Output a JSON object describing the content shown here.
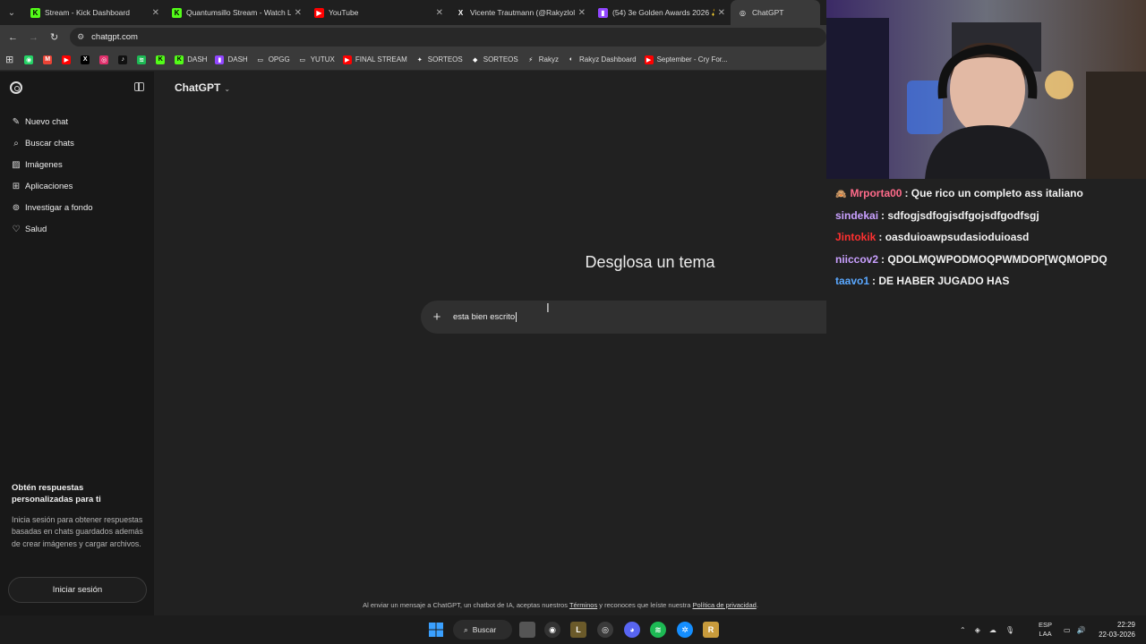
{
  "browser": {
    "tabs": [
      {
        "title": "Stream - Kick Dashboard",
        "favicon": "kick-icon",
        "color": "#53fc18",
        "glyph": "K"
      },
      {
        "title": "Quantumsillo Stream - Watch L",
        "favicon": "kick-icon",
        "color": "#53fc18",
        "glyph": "K"
      },
      {
        "title": "YouTube",
        "favicon": "youtube-icon",
        "color": "#ff0000",
        "glyph": "▶"
      },
      {
        "title": "Vicente Trautmann (@Rakyzlol",
        "favicon": "x-icon",
        "color": "#1f1f1f",
        "glyph": "X"
      },
      {
        "title": "(54) 3e Golden Awards 2026 ✨",
        "favicon": "twitch-icon",
        "color": "#9146ff",
        "glyph": "▮"
      },
      {
        "title": "ChatGPT",
        "favicon": "chatgpt-icon",
        "color": "#3a3a3a",
        "glyph": "◎"
      }
    ],
    "url": "chatgpt.com",
    "bookmarks": [
      {
        "label": "",
        "icon": "whatsapp-icon",
        "color": "#25d366",
        "glyph": "◉"
      },
      {
        "label": "",
        "icon": "gmail-icon",
        "color": "#ea4335",
        "glyph": "M"
      },
      {
        "label": "",
        "icon": "youtube-icon",
        "color": "#ff0000",
        "glyph": "▶"
      },
      {
        "label": "",
        "icon": "x-icon",
        "color": "#000000",
        "glyph": "X"
      },
      {
        "label": "",
        "icon": "instagram-icon",
        "color": "#e1306c",
        "glyph": "◎"
      },
      {
        "label": "",
        "icon": "tiktok-icon",
        "color": "#111111",
        "glyph": "♪"
      },
      {
        "label": "",
        "icon": "spotify-icon",
        "color": "#1db954",
        "glyph": "≋"
      },
      {
        "label": "",
        "icon": "kick-icon",
        "color": "#53fc18",
        "glyph": "K"
      },
      {
        "label": "DASH",
        "icon": "kick-icon",
        "color": "#53fc18",
        "glyph": "K"
      },
      {
        "label": "DASH",
        "icon": "twitch-icon",
        "color": "#9146ff",
        "glyph": "▮"
      },
      {
        "label": "OPGG",
        "icon": "folder-icon",
        "color": "#3a3a3a",
        "glyph": "▭"
      },
      {
        "label": "YUTUX",
        "icon": "folder-icon",
        "color": "#3a3a3a",
        "glyph": "▭"
      },
      {
        "label": "FINAL STREAM",
        "icon": "youtube-icon",
        "color": "#ff0000",
        "glyph": "▶"
      },
      {
        "label": "SORTEOS",
        "icon": "gear-icon",
        "color": "#3a3a3a",
        "glyph": "✦"
      },
      {
        "label": "SORTEOS",
        "icon": "diamond-icon",
        "color": "#3a3a3a",
        "glyph": "◆"
      },
      {
        "label": "Rakyz",
        "icon": "rakyz-icon",
        "color": "#3a3a3a",
        "glyph": "⚡"
      },
      {
        "label": "Rakyz Dashboard",
        "icon": "globe-icon",
        "color": "#3a3a3a",
        "glyph": "◐"
      },
      {
        "label": "September - Cry For...",
        "icon": "youtube-icon",
        "color": "#ff0000",
        "glyph": "▶"
      }
    ]
  },
  "sidebar": {
    "items": [
      {
        "label": "Nuevo chat",
        "icon": "new-chat-icon",
        "glyph": "✎"
      },
      {
        "label": "Buscar chats",
        "icon": "search-icon",
        "glyph": "⌕"
      },
      {
        "label": "Imágenes",
        "icon": "image-icon",
        "glyph": "▨"
      },
      {
        "label": "Aplicaciones",
        "icon": "apps-icon",
        "glyph": "⊞"
      },
      {
        "label": "Investigar a fondo",
        "icon": "telescope-icon",
        "glyph": "⊚"
      },
      {
        "label": "Salud",
        "icon": "heart-icon",
        "glyph": "♡"
      }
    ],
    "promo_title": "Obtén respuestas personalizadas para ti",
    "promo_text": "Inicia sesión para obtener respuestas basadas en chats guardados además de crear imágenes y cargar archivos.",
    "login_label": "Iniciar sesión"
  },
  "main": {
    "model_label": "ChatGPT",
    "headline": "Desglosa un tema",
    "composer_value": "esta bien escrito",
    "disclaimer_pre": "Al enviar un mensaje a ChatGPT, un chatbot de IA, aceptas nuestros ",
    "disclaimer_terms": "Términos",
    "disclaimer_mid": " y reconoces que leíste nuestra ",
    "disclaimer_privacy": "Política de privacidad",
    "disclaimer_end": "."
  },
  "stream_chat": [
    {
      "badge": "🙈",
      "name": "Mrporta00",
      "color": "#ff6b8a",
      "message": ": Que rico un completo ass italiano"
    },
    {
      "badge": "",
      "name": "sindekai",
      "color": "#c9a0ff",
      "message": ": sdfogjsdfogjsdfgojsdfgodfsgj"
    },
    {
      "badge": "",
      "name": "Jintokik",
      "color": "#ff3030",
      "message": ": oasduioawpsudasioduioasd"
    },
    {
      "badge": "",
      "name": "niiccov2",
      "color": "#c9a0ff",
      "message": ": QDOLMQWPODMOQPWMDOP[WQMOPDQ"
    },
    {
      "badge": "",
      "name": "taavo1",
      "color": "#5aa8ff",
      "message": ": DE HABER JUGADO HAS"
    }
  ],
  "taskbar": {
    "search_label": "Buscar",
    "lang_top": "ESP",
    "lang_bottom": "LAA",
    "time": "22:29",
    "date": "22-03-2026"
  }
}
